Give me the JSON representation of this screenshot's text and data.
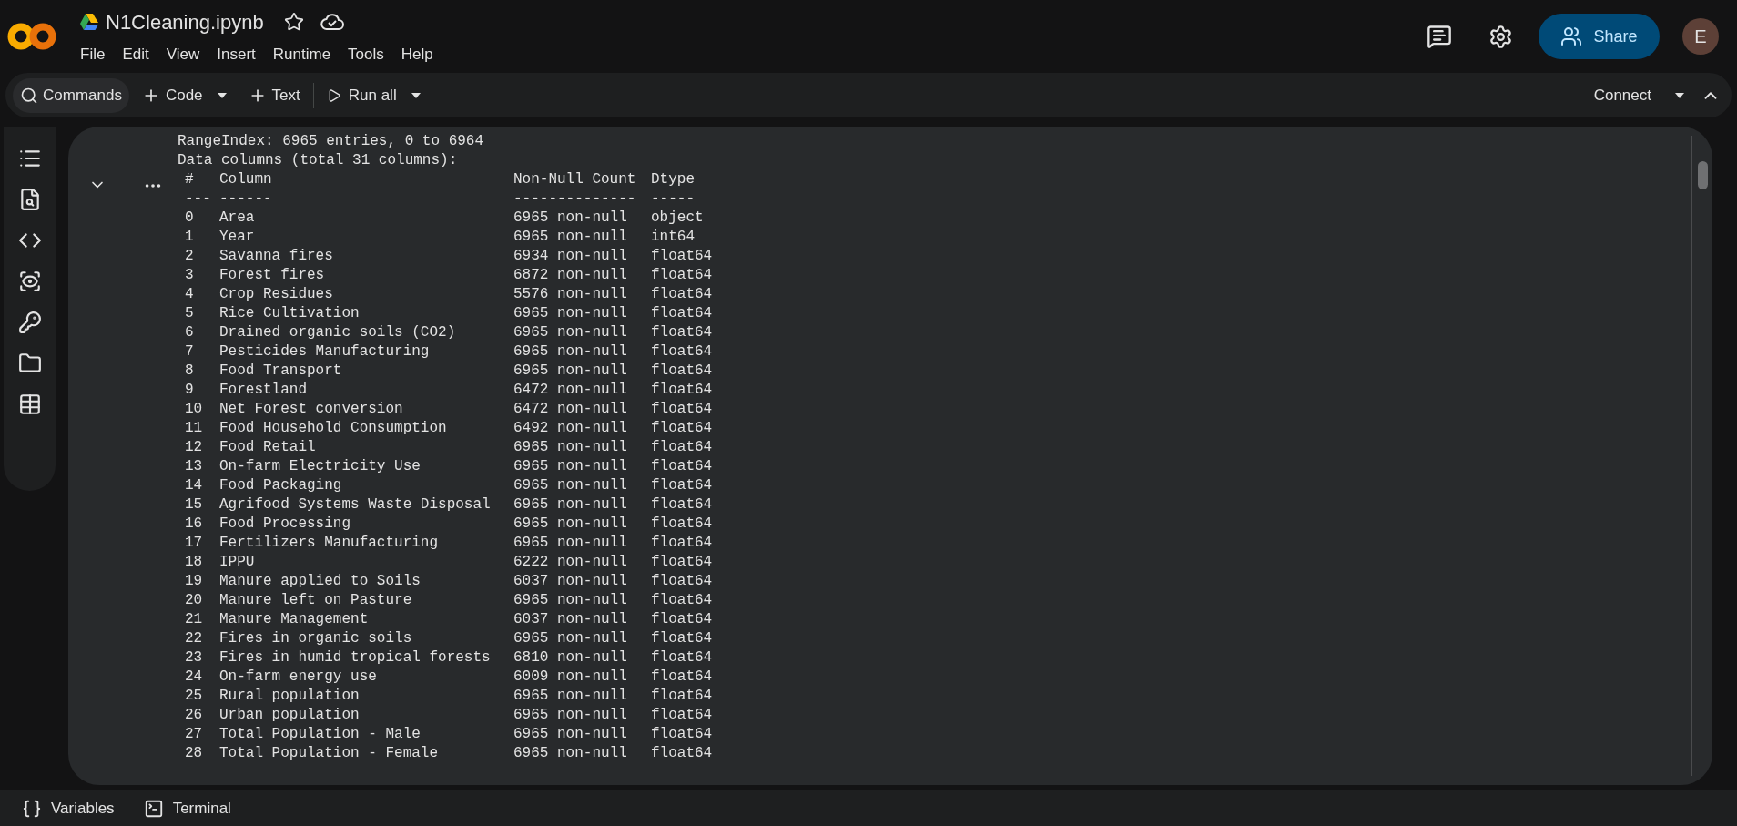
{
  "notebook": {
    "title": "N1Cleaning.ipynb",
    "menu": [
      "File",
      "Edit",
      "View",
      "Insert",
      "Runtime",
      "Tools",
      "Help"
    ],
    "share": "Share",
    "avatar": "E"
  },
  "toolbar": {
    "commands": "Commands",
    "code": "Code",
    "text": "Text",
    "run_all": "Run all",
    "connect": "Connect"
  },
  "output": {
    "lines": [
      "RangeIndex: 6965 entries, 0 to 6964",
      "Data columns (total 31 columns):"
    ],
    "header": {
      "index": "#",
      "column": "Column",
      "count": "Non-Null Count",
      "dtype": "Dtype"
    },
    "separator": {
      "index": "---",
      "column": "------",
      "count": "--------------",
      "dtype": "-----"
    },
    "rows": [
      {
        "index": "0",
        "column": "Area",
        "count": "6965 non-null",
        "dtype": "object"
      },
      {
        "index": "1",
        "column": "Year",
        "count": "6965 non-null",
        "dtype": "int64"
      },
      {
        "index": "2",
        "column": "Savanna fires",
        "count": "6934 non-null",
        "dtype": "float64"
      },
      {
        "index": "3",
        "column": "Forest fires",
        "count": "6872 non-null",
        "dtype": "float64"
      },
      {
        "index": "4",
        "column": "Crop Residues",
        "count": "5576 non-null",
        "dtype": "float64"
      },
      {
        "index": "5",
        "column": "Rice Cultivation",
        "count": "6965 non-null",
        "dtype": "float64"
      },
      {
        "index": "6",
        "column": "Drained organic soils (CO2)",
        "count": "6965 non-null",
        "dtype": "float64"
      },
      {
        "index": "7",
        "column": "Pesticides Manufacturing",
        "count": "6965 non-null",
        "dtype": "float64"
      },
      {
        "index": "8",
        "column": "Food Transport",
        "count": "6965 non-null",
        "dtype": "float64"
      },
      {
        "index": "9",
        "column": "Forestland",
        "count": "6472 non-null",
        "dtype": "float64"
      },
      {
        "index": "10",
        "column": "Net Forest conversion",
        "count": "6472 non-null",
        "dtype": "float64"
      },
      {
        "index": "11",
        "column": "Food Household Consumption",
        "count": "6492 non-null",
        "dtype": "float64"
      },
      {
        "index": "12",
        "column": "Food Retail",
        "count": "6965 non-null",
        "dtype": "float64"
      },
      {
        "index": "13",
        "column": "On-farm Electricity Use",
        "count": "6965 non-null",
        "dtype": "float64"
      },
      {
        "index": "14",
        "column": "Food Packaging",
        "count": "6965 non-null",
        "dtype": "float64"
      },
      {
        "index": "15",
        "column": "Agrifood Systems Waste Disposal",
        "count": "6965 non-null",
        "dtype": "float64"
      },
      {
        "index": "16",
        "column": "Food Processing",
        "count": "6965 non-null",
        "dtype": "float64"
      },
      {
        "index": "17",
        "column": "Fertilizers Manufacturing",
        "count": "6965 non-null",
        "dtype": "float64"
      },
      {
        "index": "18",
        "column": "IPPU",
        "count": "6222 non-null",
        "dtype": "float64"
      },
      {
        "index": "19",
        "column": "Manure applied to Soils",
        "count": "6037 non-null",
        "dtype": "float64"
      },
      {
        "index": "20",
        "column": "Manure left on Pasture",
        "count": "6965 non-null",
        "dtype": "float64"
      },
      {
        "index": "21",
        "column": "Manure Management",
        "count": "6037 non-null",
        "dtype": "float64"
      },
      {
        "index": "22",
        "column": "Fires in organic soils",
        "count": "6965 non-null",
        "dtype": "float64"
      },
      {
        "index": "23",
        "column": "Fires in humid tropical forests",
        "count": "6810 non-null",
        "dtype": "float64"
      },
      {
        "index": "24",
        "column": "On-farm energy use",
        "count": "6009 non-null",
        "dtype": "float64"
      },
      {
        "index": "25",
        "column": "Rural population",
        "count": "6965 non-null",
        "dtype": "float64"
      },
      {
        "index": "26",
        "column": "Urban population",
        "count": "6965 non-null",
        "dtype": "float64"
      },
      {
        "index": "27",
        "column": "Total Population - Male",
        "count": "6965 non-null",
        "dtype": "float64"
      },
      {
        "index": "28",
        "column": "Total Population - Female",
        "count": "6965 non-null",
        "dtype": "float64"
      }
    ]
  },
  "bottom": [
    {
      "kind": "variables",
      "label": "Variables"
    },
    {
      "kind": "terminal",
      "label": "Terminal"
    }
  ]
}
